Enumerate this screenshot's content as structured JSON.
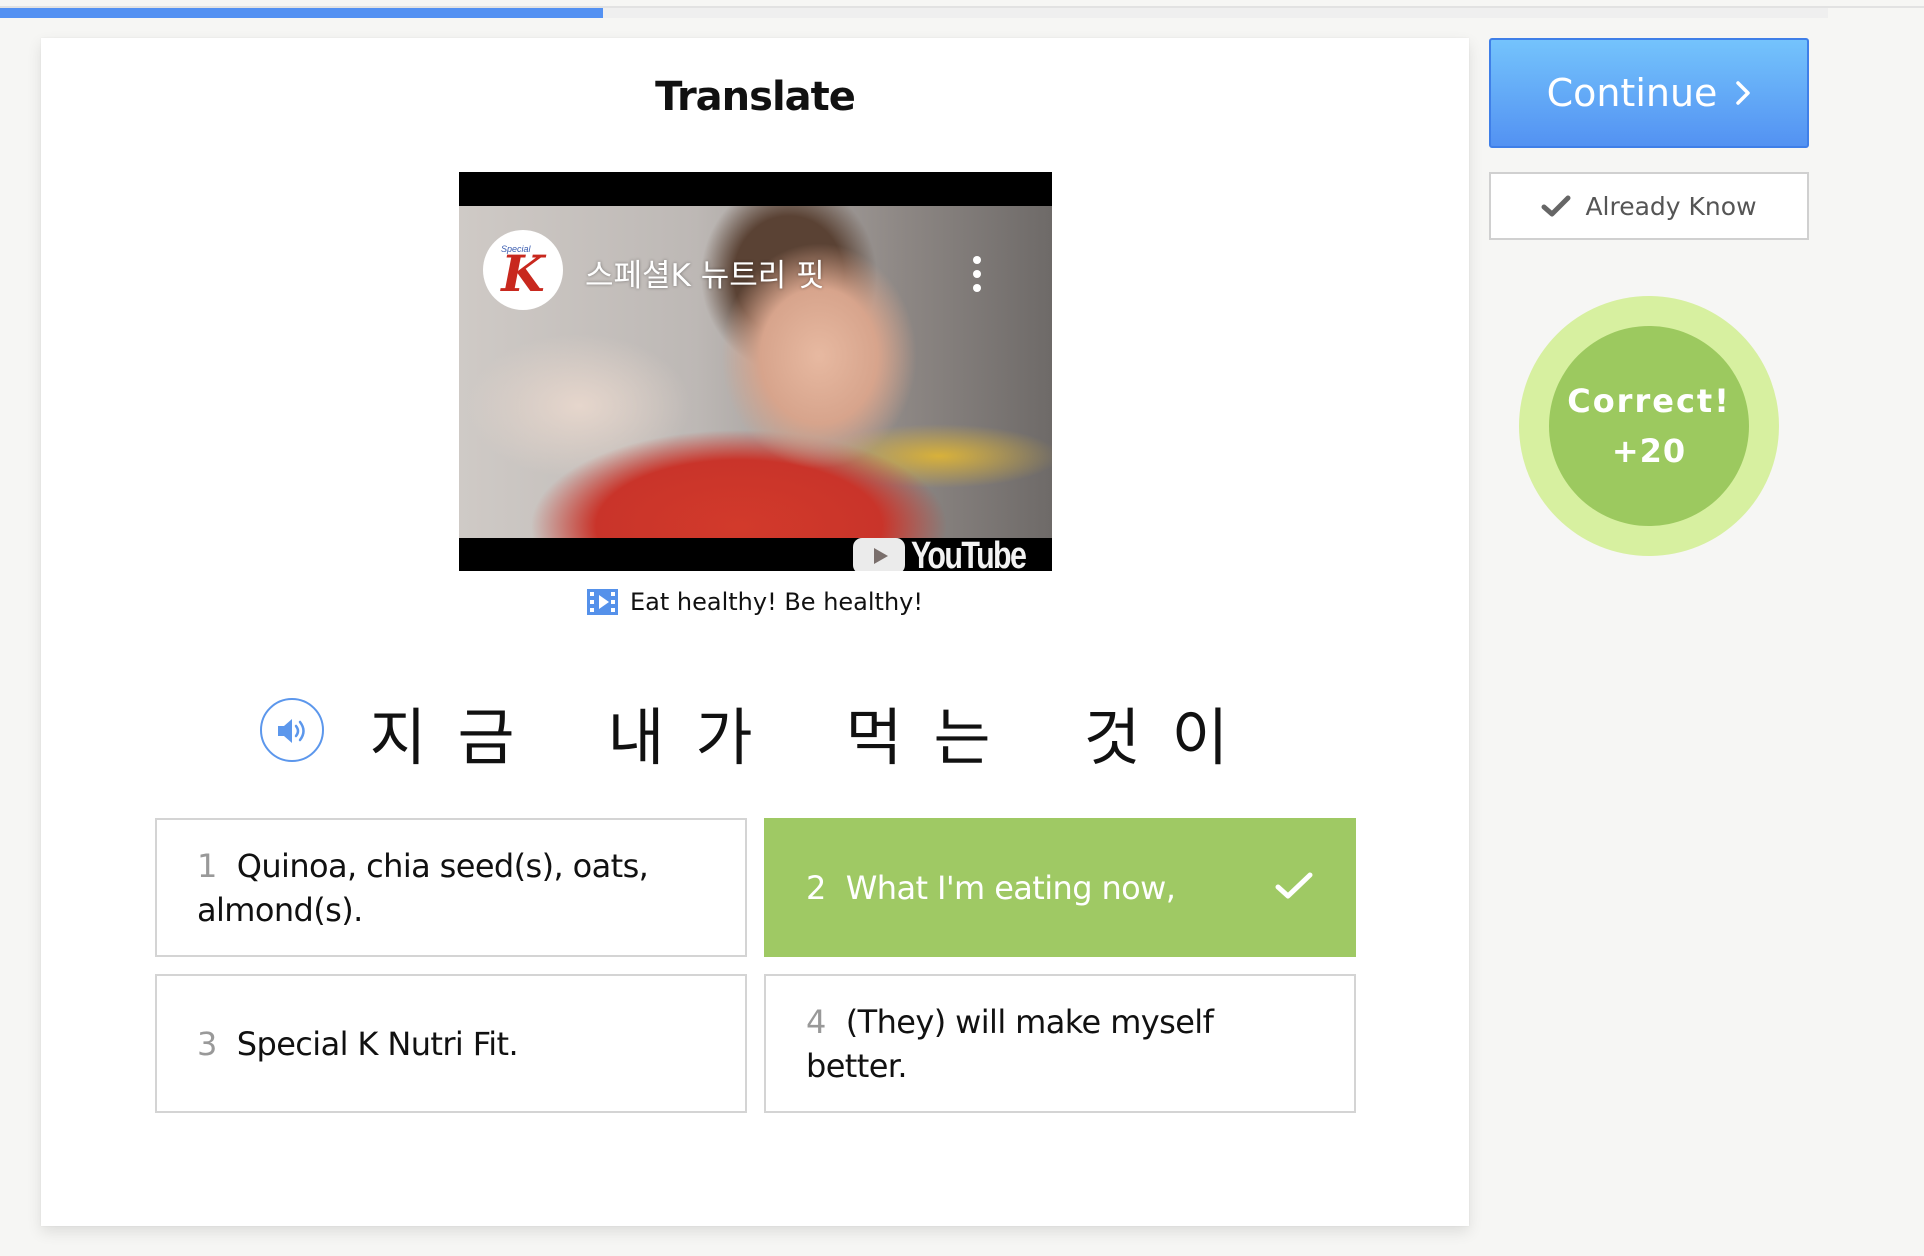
{
  "progress": {
    "percent": 33,
    "color": "#5391f2"
  },
  "exercise": {
    "title": "Translate",
    "video": {
      "channel_logo_text": "Special",
      "channel_logo_letter": "K",
      "title": "스페셜K 뉴트리 핏",
      "platform_label": "YouTube"
    },
    "caption": "Eat healthy! Be healthy!",
    "sentence_words": [
      {
        "chars": [
          "지",
          "금"
        ]
      },
      {
        "chars": [
          "내",
          "가"
        ]
      },
      {
        "chars": [
          "먹",
          "는"
        ]
      },
      {
        "chars": [
          "것",
          "이"
        ]
      }
    ],
    "options": [
      {
        "number": "1",
        "text": "Quinoa, chia seed(s), oats, almond(s).",
        "state": "default"
      },
      {
        "number": "2",
        "text": "What I'm eating now,",
        "state": "correct"
      },
      {
        "number": "3",
        "text": "Special K Nutri Fit.",
        "state": "default"
      },
      {
        "number": "4",
        "text": "(They) will make myself better.",
        "state": "default"
      }
    ]
  },
  "sidebar": {
    "continue_label": "Continue",
    "already_know_label": "Already Know",
    "feedback": {
      "label": "Correct!",
      "points": "+20"
    }
  },
  "colors": {
    "accent_blue": "#5392f2",
    "correct_green": "#9fc964",
    "correct_halo": "#d7f0a0"
  }
}
